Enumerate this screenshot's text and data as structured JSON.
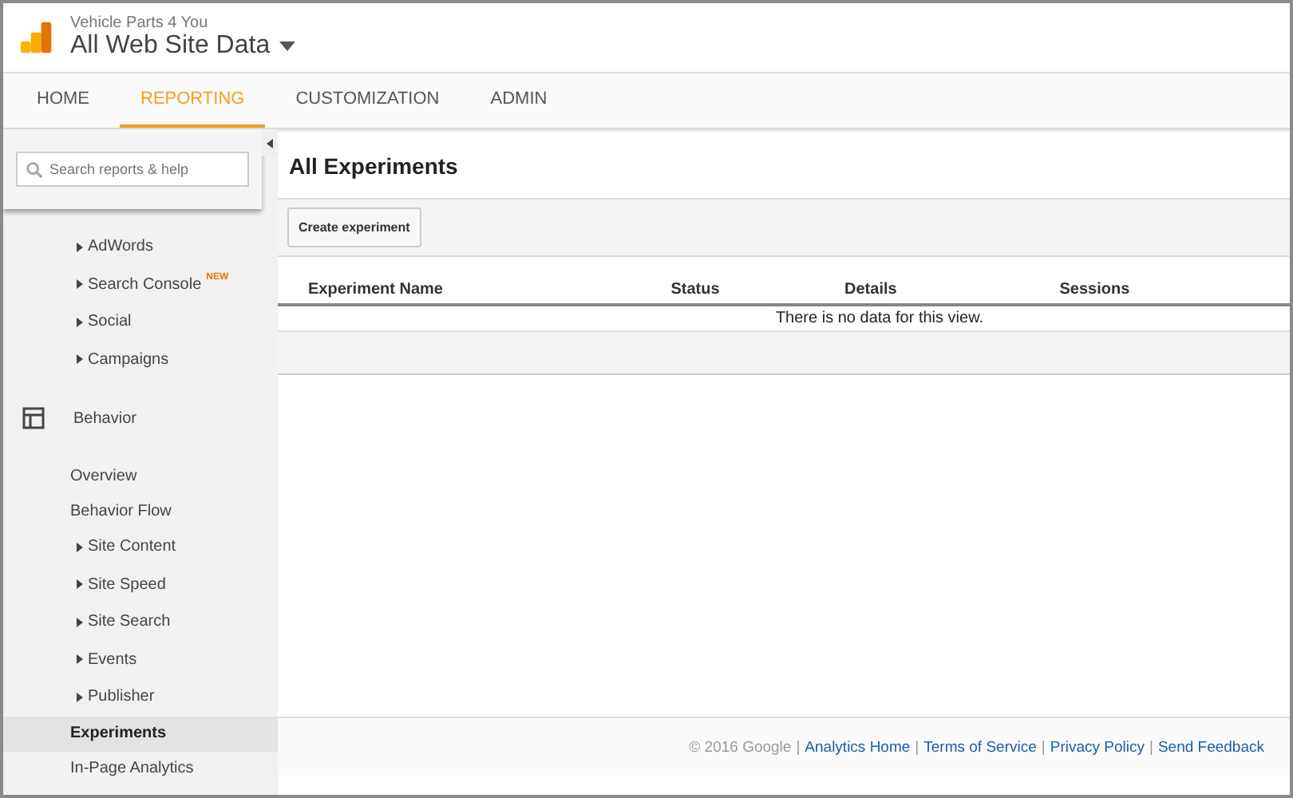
{
  "header": {
    "account": "Vehicle Parts 4 You",
    "property": "All Web Site Data"
  },
  "tabs": [
    {
      "label": "HOME",
      "selected": false
    },
    {
      "label": "REPORTING",
      "selected": true
    },
    {
      "label": "CUSTOMIZATION",
      "selected": false
    },
    {
      "label": "ADMIN",
      "selected": false
    }
  ],
  "search": {
    "placeholder": "Search reports & help"
  },
  "sidebar": {
    "items": [
      {
        "label": "AdWords",
        "kind": "expandable",
        "selected": false
      },
      {
        "label": "Search Console",
        "kind": "expandable",
        "badge": "NEW",
        "selected": false
      },
      {
        "label": "Social",
        "kind": "expandable",
        "selected": false
      },
      {
        "label": "Campaigns",
        "kind": "expandable",
        "selected": false
      },
      {
        "label": "Behavior",
        "kind": "section",
        "selected": false
      },
      {
        "label": "Overview",
        "kind": "link",
        "selected": false
      },
      {
        "label": "Behavior Flow",
        "kind": "link",
        "selected": false
      },
      {
        "label": "Site Content",
        "kind": "expandable",
        "selected": false
      },
      {
        "label": "Site Speed",
        "kind": "expandable",
        "selected": false
      },
      {
        "label": "Site Search",
        "kind": "expandable",
        "selected": false
      },
      {
        "label": "Events",
        "kind": "expandable",
        "selected": false
      },
      {
        "label": "Publisher",
        "kind": "expandable",
        "selected": false
      },
      {
        "label": "Experiments",
        "kind": "link",
        "selected": true
      },
      {
        "label": "In-Page Analytics",
        "kind": "link",
        "selected": false
      }
    ]
  },
  "main": {
    "title": "All Experiments",
    "create_button": "Create experiment",
    "table": {
      "columns": [
        "Experiment Name",
        "Status",
        "Details",
        "Sessions"
      ],
      "empty_message": "There is no data for this view."
    }
  },
  "footer": {
    "copyright": "© 2016 Google",
    "separator": "|",
    "links": [
      "Analytics Home",
      "Terms of Service",
      "Privacy Policy",
      "Send Feedback"
    ]
  }
}
